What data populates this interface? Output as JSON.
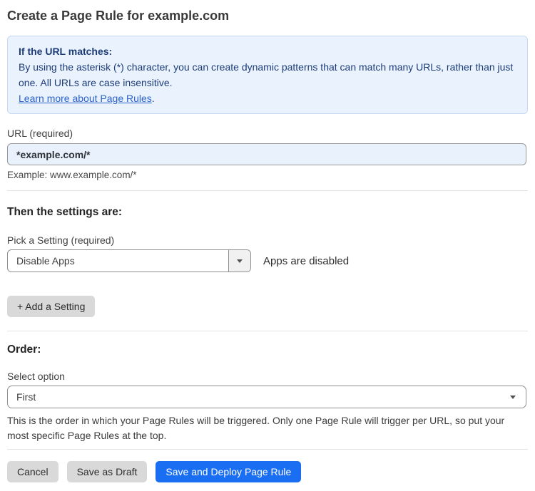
{
  "page": {
    "title": "Create a Page Rule for example.com"
  },
  "info_box": {
    "heading": "If the URL matches:",
    "body": "By using the asterisk (*) character, you can create dynamic patterns that can match many URLs, rather than just one. All URLs are case insensitive.",
    "link_label": "Learn more about Page Rules",
    "link_suffix": "."
  },
  "url_field": {
    "label": "URL (required)",
    "value": "*example.com/*",
    "helper": "Example: www.example.com/*"
  },
  "settings_section": {
    "heading": "Then the settings are:",
    "setting_label": "Pick a Setting (required)",
    "setting_value": "Disable Apps",
    "setting_status": "Apps are disabled",
    "add_setting_label": "+ Add a Setting"
  },
  "order_section": {
    "heading": "Order:",
    "label": "Select option",
    "value": "First",
    "helper": "This is the order in which your Page Rules will be triggered. Only one Page Rule will trigger per URL, so put your most specific Page Rules at the top."
  },
  "actions": {
    "cancel": "Cancel",
    "save_draft": "Save as Draft",
    "save_deploy": "Save and Deploy Page Rule"
  },
  "icons": {
    "caret_down": "▼"
  },
  "colors": {
    "accent_blue": "#1a6ef2",
    "info_bg": "#e9f2fd",
    "info_border": "#c5daf2",
    "info_text": "#1d3c78",
    "link_blue": "#2a62c9",
    "input_bg": "#e8f1fc",
    "button_gray": "#d9d9d9"
  }
}
